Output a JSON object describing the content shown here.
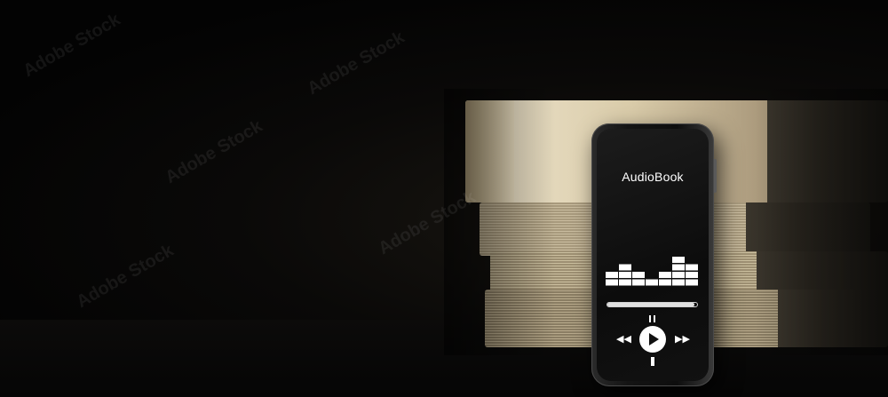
{
  "phone": {
    "app_title": "AudioBook",
    "equalizer_levels": [
      2,
      3,
      2,
      1,
      2,
      4,
      3
    ],
    "progress_fraction": 0.97
  },
  "stock_id": "490907857",
  "colors": {
    "background": "#050505",
    "book_pages": "#e5d9bc",
    "screen": "#111111",
    "icon": "#ffffff"
  },
  "icons": [
    "play-icon",
    "rewind-icon",
    "fast-forward-icon",
    "equalizer-icon"
  ]
}
